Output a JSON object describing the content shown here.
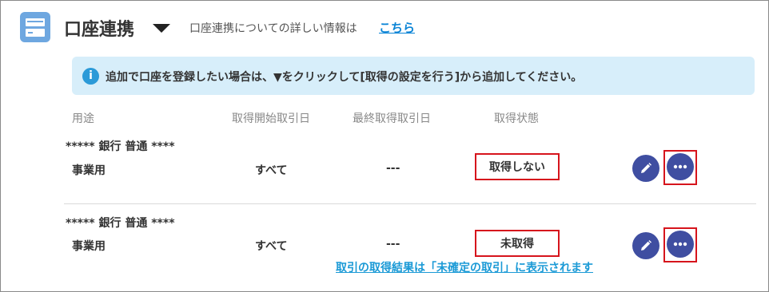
{
  "header": {
    "icon": "account-card-icon",
    "title": "口座連携",
    "info_text": "口座連携についての詳しい情報は",
    "info_link": "こちら"
  },
  "banner": {
    "icon": "info-icon",
    "icon_glyph": "i",
    "text": "追加で口座を登録したい場合は、▼をクリックして[取得の設定を行う]から追加してください。"
  },
  "columns": {
    "purpose": "用途",
    "start_date": "取得開始取引日",
    "last_date": "最終取得取引日",
    "status": "取得状態"
  },
  "rows": [
    {
      "account": "***** 銀行 普通 ****",
      "purpose": "事業用",
      "start": "すべて",
      "last": "---",
      "status": "取得しない"
    },
    {
      "account": "***** 銀行 普通 ****",
      "purpose": "事業用",
      "start": "すべて",
      "last": "---",
      "status": "未取得"
    }
  ],
  "result_link": "取引の取得結果は「未確定の取引」に表示されます",
  "colors": {
    "accent": "#3f4ea1",
    "highlight": "#d6141c",
    "link": "#0a84d6",
    "banner_bg": "#d7eefa"
  }
}
